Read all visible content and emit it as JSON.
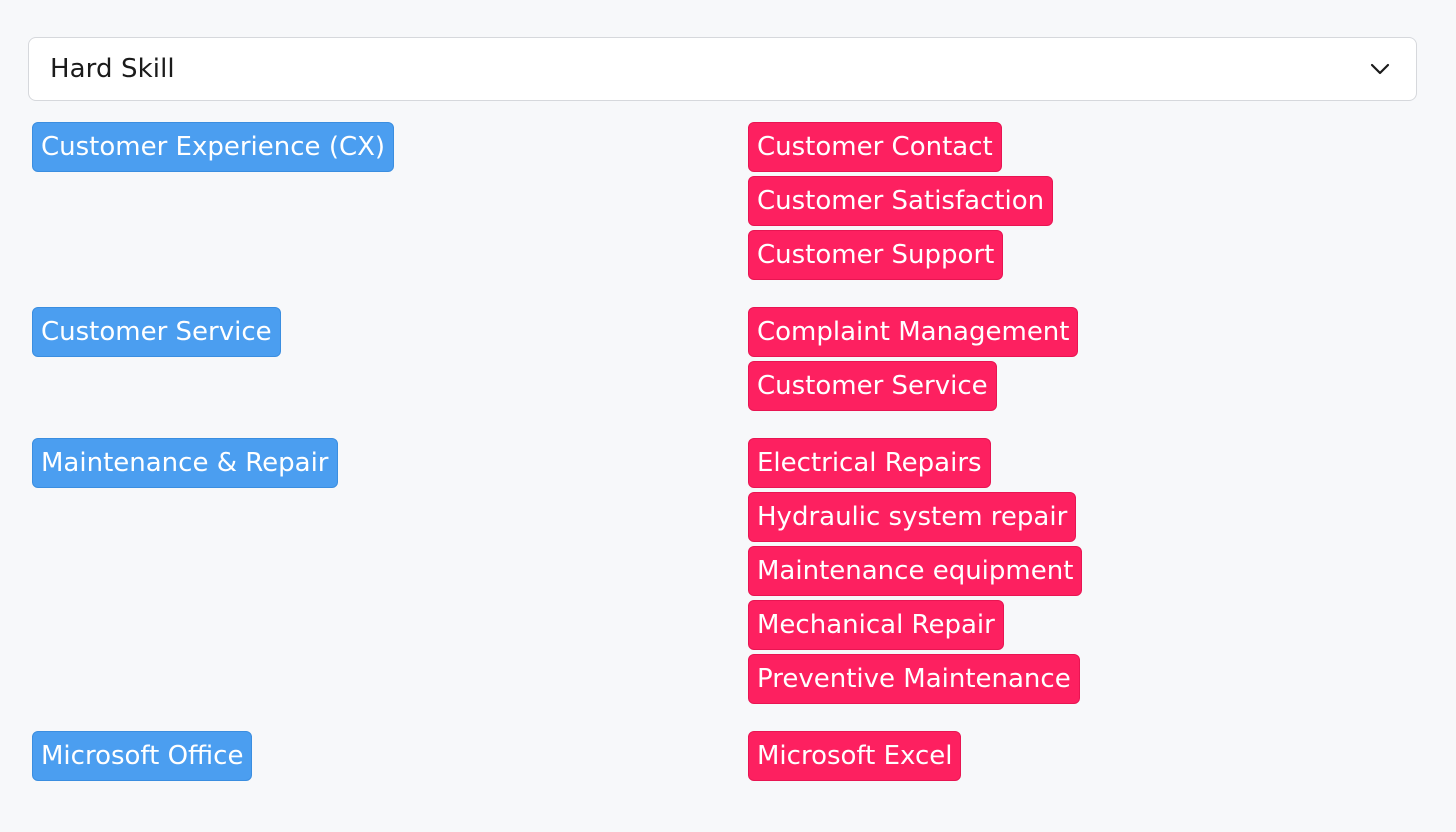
{
  "dropdown": {
    "selected": "Hard Skill",
    "icon": "chevron-down-icon"
  },
  "groups": [
    {
      "category": "Customer Experience (CX)",
      "skills": [
        "Customer Contact",
        "Customer Satisfaction",
        "Customer Support"
      ]
    },
    {
      "category": "Customer Service",
      "skills": [
        "Complaint Management",
        "Customer Service"
      ]
    },
    {
      "category": "Maintenance & Repair",
      "skills": [
        "Electrical Repairs",
        "Hydraulic system repair",
        "Maintenance equipment",
        "Mechanical Repair",
        "Preventive Maintenance"
      ]
    },
    {
      "category": "Microsoft Office",
      "skills": [
        "Microsoft Excel"
      ]
    }
  ],
  "colors": {
    "background": "#f7f8fa",
    "category_tag": "#4b9ef0",
    "skill_tag": "#fd2060"
  }
}
